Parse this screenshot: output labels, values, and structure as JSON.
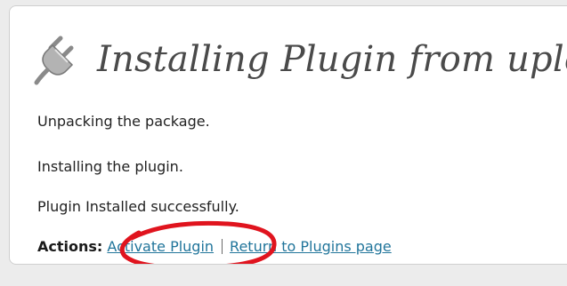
{
  "header": {
    "title": "Installing Plugin from uploa",
    "icon": "plug-icon"
  },
  "messages": [
    "Unpacking the package.",
    "Installing the plugin.",
    "Plugin Installed successfully."
  ],
  "actions": {
    "label": "Actions:",
    "activate_link": "Activate Plugin",
    "return_link": "Return to Plugins page"
  },
  "annotation": {
    "highlight_color": "#e0141e",
    "target": "activate_link"
  },
  "colors": {
    "link": "#21759b",
    "title": "#4a4a4a",
    "text": "#222222"
  }
}
